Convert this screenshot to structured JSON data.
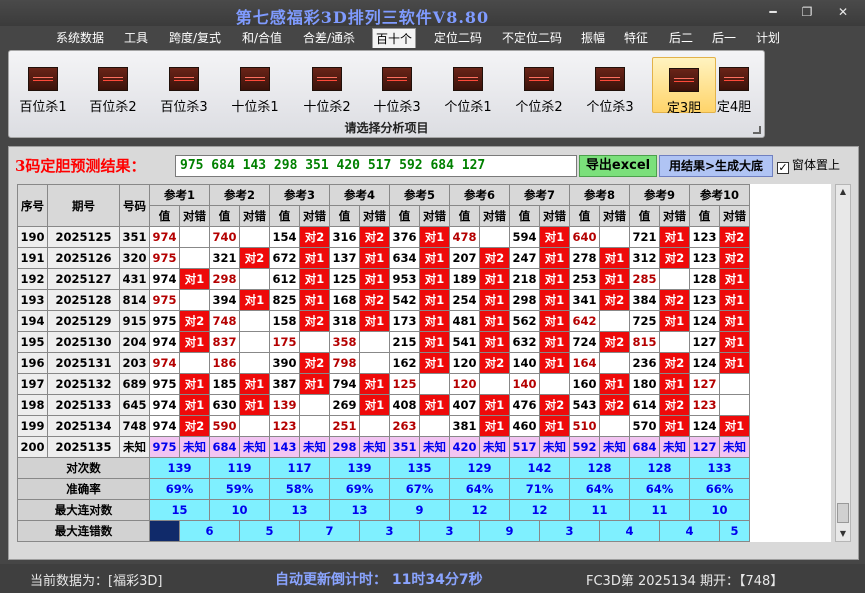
{
  "window": {
    "title": "第七感福彩3D排列三软件V8.80",
    "min_symbol": "━",
    "max_symbol": "❐",
    "close_symbol": "✕"
  },
  "menu": [
    {
      "label": "系统数据"
    },
    {
      "label": "工具"
    },
    {
      "label": "跨度/复式"
    },
    {
      "label": "和/合值"
    },
    {
      "label": "合差/通杀"
    },
    {
      "label": "百十个",
      "active": true
    },
    {
      "label": "定位二码"
    },
    {
      "label": "不定位二码"
    },
    {
      "label": "振幅"
    },
    {
      "label": "特征"
    },
    {
      "label": "后二"
    },
    {
      "label": "后一"
    },
    {
      "label": "计划"
    }
  ],
  "ribbon": {
    "caption": "请选择分析项目",
    "buttons": [
      {
        "label": "百位杀1"
      },
      {
        "label": "百位杀2"
      },
      {
        "label": "百位杀3"
      },
      {
        "label": "十位杀1"
      },
      {
        "label": "十位杀2"
      },
      {
        "label": "十位杀3"
      },
      {
        "label": "个位杀1"
      },
      {
        "label": "个位杀2"
      },
      {
        "label": "个位杀3"
      },
      {
        "label": "定3胆",
        "active": true
      },
      {
        "label": "定4胆"
      }
    ]
  },
  "prediction": {
    "label": "3码定胆预测结果：",
    "value": "975 684 143 298 351 420 517 592 684 127",
    "export_label": "导出excel",
    "generate_label": "用结果>生成大底",
    "ontop_label": "窗体置上",
    "ontop_checked": true
  },
  "table": {
    "headers": {
      "seq": "序号",
      "period": "期号",
      "number": "号码",
      "value": "值",
      "result": "对错"
    },
    "refs": [
      "参考1",
      "参考2",
      "参考3",
      "参考4",
      "参考5",
      "参考6",
      "参考7",
      "参考8",
      "参考9",
      "参考10"
    ],
    "rows": [
      {
        "seq": "190",
        "period": "2025125",
        "num": "351",
        "cells": [
          [
            "974",
            "r",
            ""
          ],
          [
            "740",
            "r",
            ""
          ],
          [
            "154",
            "k",
            "对2"
          ],
          [
            "316",
            "k",
            "对2"
          ],
          [
            "376",
            "k",
            "对1"
          ],
          [
            "478",
            "r",
            ""
          ],
          [
            "594",
            "k",
            "对1"
          ],
          [
            "640",
            "r",
            ""
          ],
          [
            "721",
            "k",
            "对1"
          ],
          [
            "123",
            "k",
            "对2"
          ]
        ]
      },
      {
        "seq": "191",
        "period": "2025126",
        "num": "320",
        "cells": [
          [
            "975",
            "r",
            ""
          ],
          [
            "321",
            "k",
            "对2"
          ],
          [
            "672",
            "k",
            "对1"
          ],
          [
            "137",
            "k",
            "对1"
          ],
          [
            "634",
            "k",
            "对1"
          ],
          [
            "207",
            "k",
            "对2"
          ],
          [
            "247",
            "k",
            "对1"
          ],
          [
            "278",
            "k",
            "对1"
          ],
          [
            "312",
            "k",
            "对2"
          ],
          [
            "123",
            "k",
            "对2"
          ]
        ]
      },
      {
        "seq": "192",
        "period": "2025127",
        "num": "431",
        "cells": [
          [
            "974",
            "k",
            "对1"
          ],
          [
            "298",
            "r",
            ""
          ],
          [
            "612",
            "k",
            "对1"
          ],
          [
            "125",
            "k",
            "对1"
          ],
          [
            "953",
            "k",
            "对1"
          ],
          [
            "189",
            "k",
            "对1"
          ],
          [
            "218",
            "k",
            "对1"
          ],
          [
            "253",
            "k",
            "对1"
          ],
          [
            "285",
            "r",
            ""
          ],
          [
            "128",
            "k",
            "对1"
          ]
        ]
      },
      {
        "seq": "193",
        "period": "2025128",
        "num": "814",
        "cells": [
          [
            "975",
            "r",
            ""
          ],
          [
            "394",
            "k",
            "对1"
          ],
          [
            "825",
            "k",
            "对1"
          ],
          [
            "168",
            "k",
            "对2"
          ],
          [
            "542",
            "k",
            "对1"
          ],
          [
            "254",
            "k",
            "对1"
          ],
          [
            "298",
            "k",
            "对1"
          ],
          [
            "341",
            "k",
            "对2"
          ],
          [
            "384",
            "k",
            "对2"
          ],
          [
            "123",
            "k",
            "对1"
          ]
        ]
      },
      {
        "seq": "194",
        "period": "2025129",
        "num": "915",
        "cells": [
          [
            "975",
            "k",
            "对2"
          ],
          [
            "748",
            "r",
            ""
          ],
          [
            "158",
            "k",
            "对2"
          ],
          [
            "318",
            "k",
            "对1"
          ],
          [
            "173",
            "k",
            "对1"
          ],
          [
            "481",
            "k",
            "对1"
          ],
          [
            "562",
            "k",
            "对1"
          ],
          [
            "642",
            "r",
            ""
          ],
          [
            "725",
            "k",
            "对1"
          ],
          [
            "124",
            "k",
            "对1"
          ]
        ]
      },
      {
        "seq": "195",
        "period": "2025130",
        "num": "204",
        "cells": [
          [
            "974",
            "k",
            "对1"
          ],
          [
            "837",
            "r",
            ""
          ],
          [
            "175",
            "r",
            ""
          ],
          [
            "358",
            "r",
            ""
          ],
          [
            "215",
            "k",
            "对1"
          ],
          [
            "541",
            "k",
            "对1"
          ],
          [
            "632",
            "k",
            "对1"
          ],
          [
            "724",
            "k",
            "对2"
          ],
          [
            "815",
            "r",
            ""
          ],
          [
            "127",
            "k",
            "对1"
          ]
        ]
      },
      {
        "seq": "196",
        "period": "2025131",
        "num": "203",
        "cells": [
          [
            "974",
            "r",
            ""
          ],
          [
            "186",
            "r",
            ""
          ],
          [
            "390",
            "k",
            "对2"
          ],
          [
            "798",
            "r",
            ""
          ],
          [
            "162",
            "k",
            "对1"
          ],
          [
            "120",
            "k",
            "对2"
          ],
          [
            "140",
            "k",
            "对1"
          ],
          [
            "164",
            "r",
            ""
          ],
          [
            "236",
            "k",
            "对2"
          ],
          [
            "124",
            "k",
            "对1"
          ]
        ]
      },
      {
        "seq": "197",
        "period": "2025132",
        "num": "689",
        "cells": [
          [
            "975",
            "k",
            "对1"
          ],
          [
            "185",
            "k",
            "对1"
          ],
          [
            "387",
            "k",
            "对1"
          ],
          [
            "794",
            "k",
            "对1"
          ],
          [
            "125",
            "r",
            ""
          ],
          [
            "120",
            "r",
            ""
          ],
          [
            "140",
            "r",
            ""
          ],
          [
            "160",
            "k",
            "对1"
          ],
          [
            "180",
            "k",
            "对1"
          ],
          [
            "127",
            "r",
            ""
          ]
        ]
      },
      {
        "seq": "198",
        "period": "2025133",
        "num": "645",
        "cells": [
          [
            "974",
            "k",
            "对1"
          ],
          [
            "630",
            "k",
            "对1"
          ],
          [
            "139",
            "r",
            ""
          ],
          [
            "269",
            "k",
            "对1"
          ],
          [
            "408",
            "k",
            "对1"
          ],
          [
            "407",
            "k",
            "对1"
          ],
          [
            "476",
            "k",
            "对2"
          ],
          [
            "543",
            "k",
            "对2"
          ],
          [
            "614",
            "k",
            "对2"
          ],
          [
            "123",
            "r",
            ""
          ]
        ]
      },
      {
        "seq": "199",
        "period": "2025134",
        "num": "748",
        "cells": [
          [
            "974",
            "k",
            "对2"
          ],
          [
            "590",
            "r",
            ""
          ],
          [
            "123",
            "r",
            ""
          ],
          [
            "251",
            "r",
            ""
          ],
          [
            "263",
            "r",
            ""
          ],
          [
            "381",
            "k",
            "对1"
          ],
          [
            "460",
            "k",
            "对1"
          ],
          [
            "510",
            "r",
            ""
          ],
          [
            "570",
            "k",
            "对1"
          ],
          [
            "124",
            "k",
            "对1"
          ]
        ]
      }
    ],
    "predict_row": {
      "seq": "200",
      "period": "2025135",
      "num": "未知",
      "values": [
        "975",
        "684",
        "143",
        "298",
        "351",
        "420",
        "517",
        "592",
        "684",
        "127"
      ],
      "unknown": "未知"
    },
    "stats": [
      {
        "label": "对次数",
        "values": [
          "139",
          "119",
          "117",
          "139",
          "135",
          "129",
          "142",
          "128",
          "128",
          "133"
        ]
      },
      {
        "label": "准确率",
        "values": [
          "69%",
          "59%",
          "58%",
          "69%",
          "67%",
          "64%",
          "71%",
          "64%",
          "64%",
          "66%"
        ]
      },
      {
        "label": "最大连对数",
        "values": [
          "15",
          "10",
          "13",
          "13",
          "9",
          "12",
          "12",
          "11",
          "11",
          "10"
        ]
      },
      {
        "label": "最大连错数",
        "values": [
          "",
          "6",
          "5",
          "7",
          "3",
          "3",
          "9",
          "3",
          "4",
          "4",
          "5"
        ]
      }
    ]
  },
  "status": {
    "left": "当前数据为：[福彩3D]",
    "mid": "自动更新倒计时：  11时34分7秒",
    "right": "FC3D第 2025134 期开：【748】"
  }
}
